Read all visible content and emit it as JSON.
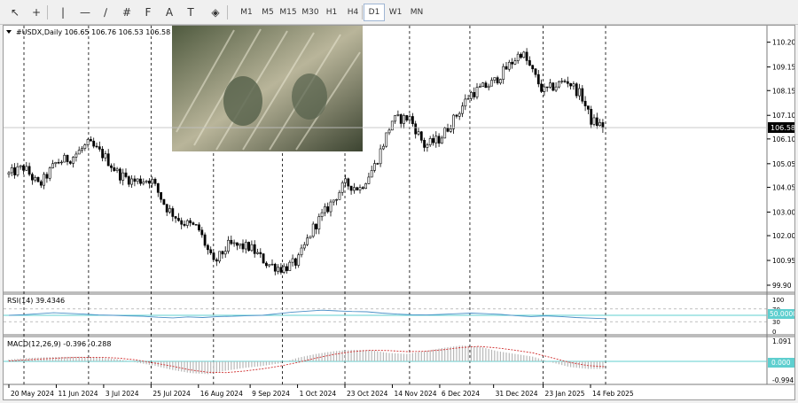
{
  "toolbar": {
    "tools": [
      {
        "name": "cursor-icon",
        "glyph": "↖"
      },
      {
        "name": "crosshair-icon",
        "glyph": "+"
      },
      {
        "name": "vertical-line-icon",
        "glyph": "|"
      },
      {
        "name": "horizontal-line-icon",
        "glyph": "—"
      },
      {
        "name": "trendline-icon",
        "glyph": "∕"
      },
      {
        "name": "channel-icon",
        "glyph": "#"
      },
      {
        "name": "fibonacci-icon",
        "glyph": "F"
      },
      {
        "name": "text-icon",
        "glyph": "A"
      },
      {
        "name": "text-label-icon",
        "glyph": "T"
      },
      {
        "name": "shapes-icon",
        "glyph": "◈"
      }
    ],
    "timeframes": [
      "M1",
      "M5",
      "M15",
      "M30",
      "H1",
      "H4",
      "D1",
      "W1",
      "MN"
    ],
    "active_timeframe": "D1"
  },
  "chart": {
    "header": "#USDX,Daily  106.65 106.76 106.53 106.58",
    "last_price_label": "106.58",
    "rsi_header": "RSI(14) 39.4346",
    "macd_header": "MACD(12,26,9) -0.396 -0.288",
    "rsi_level_label": "50.0000",
    "macd_zero_label": "0.000",
    "photo_alt": "banknotes-photo"
  },
  "colors": {
    "candle": "#000000",
    "rsi_line": "#4a8fc7",
    "rsi_level": "#5fcfcf",
    "macd_hist": "#b8b8b8",
    "macd_signal": "#d03030",
    "grid_dash": "#000000",
    "last_price_bg": "#000000",
    "level_label_bg": "#5fcfcf"
  },
  "chart_data": [
    {
      "type": "candlestick",
      "y_ticks": [
        110.2,
        109.15,
        108.15,
        107.1,
        106.1,
        105.05,
        104.05,
        103.0,
        102.0,
        100.95,
        99.9
      ],
      "ylim": [
        99.9,
        110.6
      ],
      "x_tick_labels": [
        "20 May 2024",
        "11 Jun 2024",
        "3 Jul 2024",
        "25 Jul 2024",
        "16 Aug 2024",
        "9 Sep 2024",
        "1 Oct 2024",
        "23 Oct 2024",
        "14 Nov 2024",
        "6 Dec 2024",
        "31 Dec 2024",
        "23 Jan 2025",
        "14 Feb 2025"
      ],
      "close_path": [
        [
          "2024-05-20",
          104.6
        ],
        [
          "2024-05-27",
          104.9
        ],
        [
          "2024-06-03",
          104.1
        ],
        [
          "2024-06-11",
          105.1
        ],
        [
          "2024-06-18",
          105.3
        ],
        [
          "2024-06-26",
          105.9
        ],
        [
          "2024-07-03",
          105.4
        ],
        [
          "2024-07-10",
          104.6
        ],
        [
          "2024-07-17",
          104.3
        ],
        [
          "2024-07-25",
          104.4
        ],
        [
          "2024-08-01",
          103.2
        ],
        [
          "2024-08-08",
          102.6
        ],
        [
          "2024-08-16",
          102.3
        ],
        [
          "2024-08-23",
          100.8
        ],
        [
          "2024-08-30",
          101.6
        ],
        [
          "2024-09-09",
          101.5
        ],
        [
          "2024-09-17",
          100.8
        ],
        [
          "2024-09-24",
          100.6
        ],
        [
          "2024-10-01",
          100.9
        ],
        [
          "2024-10-08",
          102.3
        ],
        [
          "2024-10-16",
          103.3
        ],
        [
          "2024-10-23",
          104.2
        ],
        [
          "2024-10-30",
          104.0
        ],
        [
          "2024-11-06",
          105.0
        ],
        [
          "2024-11-14",
          106.9
        ],
        [
          "2024-11-22",
          107.0
        ],
        [
          "2024-11-29",
          105.8
        ],
        [
          "2024-12-06",
          106.1
        ],
        [
          "2024-12-13",
          107.0
        ],
        [
          "2024-12-20",
          108.0
        ],
        [
          "2024-12-31",
          108.5
        ],
        [
          "2025-01-08",
          109.3
        ],
        [
          "2025-01-13",
          109.8
        ],
        [
          "2025-01-23",
          108.1
        ],
        [
          "2025-02-03",
          108.6
        ],
        [
          "2025-02-10",
          107.9
        ],
        [
          "2025-02-14",
          106.9
        ],
        [
          "2025-02-21",
          106.58
        ]
      ]
    },
    {
      "type": "line",
      "name": "RSI(14)",
      "ylim": [
        0,
        100
      ],
      "y_ticks": [
        100,
        70,
        50,
        30,
        0
      ],
      "levels": [
        70,
        50,
        30
      ],
      "values": [
        50,
        52,
        55,
        58,
        56,
        54,
        51,
        50,
        48,
        47,
        44,
        42,
        45,
        43,
        46,
        47,
        49,
        50,
        55,
        60,
        63,
        66,
        64,
        62,
        61,
        57,
        54,
        52,
        51,
        53,
        55,
        57,
        55,
        53,
        49,
        46,
        48,
        46,
        43,
        41,
        39.43
      ]
    },
    {
      "type": "bar+line",
      "name": "MACD(12,26,9)",
      "ylim": [
        -0.994,
        1.091
      ],
      "y_ticks": [
        1.091,
        0.0,
        -0.994
      ],
      "macd": [
        0.1,
        0.18,
        0.22,
        0.24,
        0.25,
        0.2,
        0.12,
        -0.05,
        -0.22,
        -0.45,
        -0.62,
        -0.68,
        -0.5,
        -0.35,
        -0.25,
        -0.1,
        0.2,
        0.4,
        0.55,
        0.62,
        0.6,
        0.45,
        0.4,
        0.55,
        0.72,
        0.85,
        0.8,
        0.55,
        0.4,
        0.25,
        -0.05,
        -0.3,
        -0.4,
        -0.396
      ],
      "signal": [
        0.02,
        0.08,
        0.14,
        0.19,
        0.22,
        0.22,
        0.18,
        0.08,
        -0.08,
        -0.25,
        -0.45,
        -0.58,
        -0.6,
        -0.52,
        -0.4,
        -0.25,
        -0.05,
        0.18,
        0.38,
        0.52,
        0.6,
        0.58,
        0.52,
        0.54,
        0.62,
        0.74,
        0.8,
        0.72,
        0.6,
        0.45,
        0.2,
        -0.05,
        -0.22,
        -0.288
      ]
    }
  ]
}
